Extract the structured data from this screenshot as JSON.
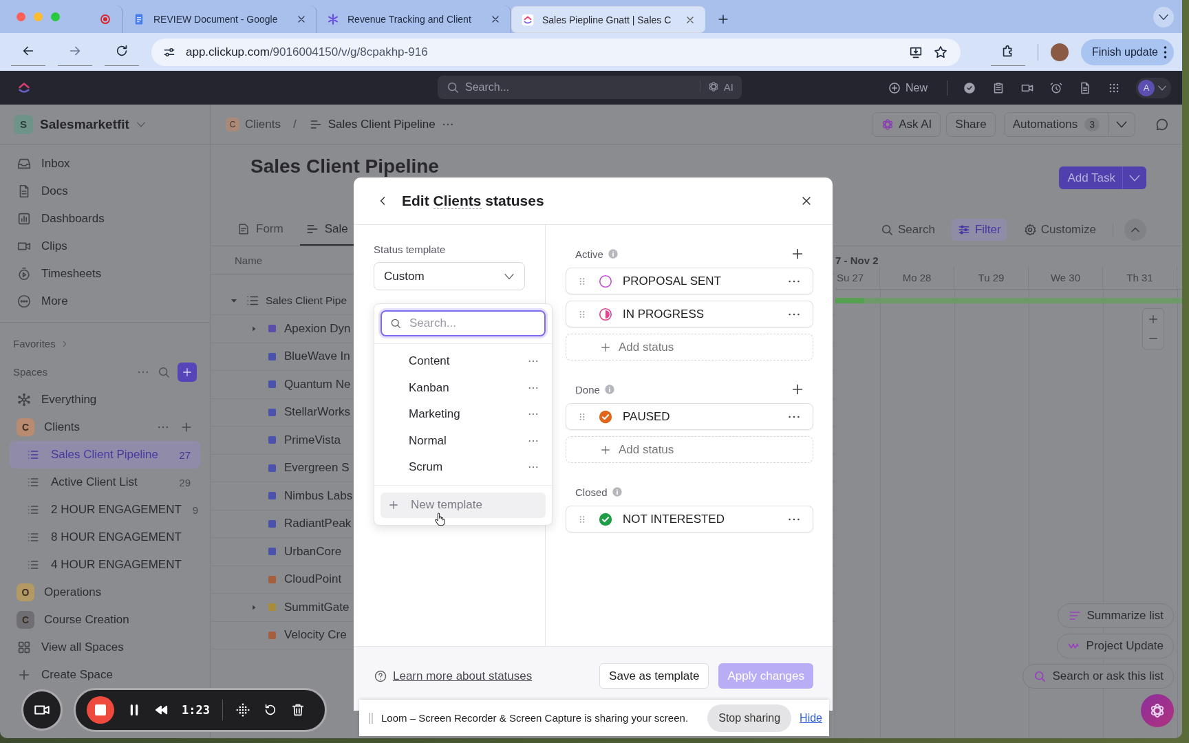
{
  "browser": {
    "tabs": [
      {
        "kind": "record",
        "selected": false
      },
      {
        "kind": "doc",
        "title": "REVIEW Document - Google",
        "selected": false
      },
      {
        "kind": "app",
        "title": "Revenue Tracking and Client",
        "selected": false
      },
      {
        "kind": "clickup",
        "title": "Sales Piepline Gnatt | Sales C",
        "selected": true
      }
    ],
    "url_host": "app.clickup.com",
    "url_path": "/9016004150/v/g/8cpakhp-916",
    "update_button": "Finish update"
  },
  "topbar": {
    "search_placeholder": "Search...",
    "ai_label": "AI",
    "new_label": "New",
    "avatar_letter": "A"
  },
  "sidebar": {
    "workspace": {
      "letter": "S",
      "name": "Salesmarketfit"
    },
    "nav": [
      {
        "kind": "inbox",
        "label": "Inbox"
      },
      {
        "kind": "doc",
        "label": "Docs"
      },
      {
        "kind": "dashboard",
        "label": "Dashboards"
      },
      {
        "kind": "clips",
        "label": "Clips"
      },
      {
        "kind": "timesheet",
        "label": "Timesheets"
      },
      {
        "kind": "more",
        "label": "More"
      }
    ],
    "favorites_label": "Favorites",
    "spaces_label": "Spaces",
    "spaces": [
      {
        "kind": "everything",
        "label": "Everything"
      },
      {
        "kind": "space",
        "letter": "C",
        "label": "Clients",
        "color": "#b98b70",
        "expanded": true,
        "children": [
          {
            "label": "Sales Client Pipeline",
            "count": "27",
            "selected": true
          },
          {
            "label": "Active Client List",
            "count": "29",
            "selected": false
          },
          {
            "label": "2 HOUR ENGAGEMENT",
            "count": "9",
            "selected": false
          },
          {
            "label": "8 HOUR ENGAGEMENT",
            "selected": false
          },
          {
            "label": "4 HOUR ENGAGEMENT",
            "selected": false
          }
        ]
      },
      {
        "kind": "space",
        "letter": "O",
        "label": "Operations",
        "color": "#b39a64",
        "expanded": false
      },
      {
        "kind": "space",
        "letter": "C",
        "label": "Course Creation",
        "color": "#6e6e73",
        "expanded": false
      },
      {
        "kind": "all",
        "label": "View all Spaces"
      },
      {
        "kind": "create",
        "label": "Create Space"
      }
    ]
  },
  "main": {
    "breadcrumb": {
      "space_letter": "C",
      "space": "Clients",
      "separator": "/",
      "list": "Sales Client Pipeline"
    },
    "ask_ai": "Ask AI",
    "share": "Share",
    "automations": {
      "label": "Automations",
      "count": "3"
    },
    "title": "Sales Client Pipeline",
    "add_task": "Add Task",
    "view_tabs": [
      {
        "kind": "form",
        "label": "Form",
        "selected": false
      },
      {
        "kind": "gantt",
        "label": "Sale",
        "selected": true
      }
    ],
    "toolbar": [
      {
        "kind": "search",
        "label": "Search",
        "active": false
      },
      {
        "kind": "filter",
        "label": "Filter",
        "active": true
      },
      {
        "kind": "customize",
        "label": "Customize",
        "active": false
      }
    ],
    "list": {
      "column": "Name",
      "group": {
        "label": "Sales Client Pipe",
        "expanded": true
      },
      "rows": [
        {
          "name": "Apexion Dyn",
          "color": "#5a4dab",
          "has_children": true
        },
        {
          "name": "BlueWave In",
          "color": "#4a52ad",
          "has_children": false
        },
        {
          "name": "Quantum Ne",
          "color": "#4a52ad",
          "has_children": false
        },
        {
          "name": "StellarWorks",
          "color": "#4a52ad",
          "has_children": false
        },
        {
          "name": "PrimeVista",
          "color": "#4a52ad",
          "has_children": false
        },
        {
          "name": "Evergreen S",
          "color": "#4a52ad",
          "has_children": false
        },
        {
          "name": "Nimbus Labs",
          "color": "#4a52ad",
          "has_children": false
        },
        {
          "name": "RadiantPeak",
          "color": "#4a52ad",
          "has_children": false
        },
        {
          "name": "UrbanCore",
          "color": "#4a52ad",
          "has_children": false
        },
        {
          "name": "CloudPoint",
          "color": "#a65f3c",
          "has_children": false
        },
        {
          "name": "SummitGate",
          "color": "#a88c3c",
          "has_children": true
        },
        {
          "name": "Velocity Cre",
          "color": "#a65f3c",
          "has_children": false
        }
      ]
    },
    "gantt": {
      "range": "7 - Nov 2",
      "days": [
        "Su 27",
        "Mo 28",
        "Tu 29",
        "We 30",
        "Th 31"
      ]
    },
    "ai_actions": [
      {
        "kind": "summarize",
        "label": "Summarize list"
      },
      {
        "kind": "update",
        "label": "Project Update"
      },
      {
        "kind": "ask",
        "label": "Search or ask this list"
      }
    ]
  },
  "modal": {
    "title_before": "Edit",
    "space": "Clients",
    "title_after": "statuses",
    "template_label": "Status template",
    "template_value": "Custom",
    "template_search_placeholder": "Search...",
    "templates": [
      {
        "label": "Content"
      },
      {
        "label": "Kanban"
      },
      {
        "label": "Marketing"
      },
      {
        "label": "Normal"
      },
      {
        "label": "Scrum"
      }
    ],
    "new_template": "New template",
    "groups": [
      {
        "label": "Active",
        "can_add": true,
        "add_label": "Add status",
        "statuses": [
          {
            "name": "PROPOSAL SENT",
            "kind": "open",
            "color": "#c250d8"
          },
          {
            "name": "IN PROGRESS",
            "kind": "in_progress",
            "color": "#e0458f"
          }
        ]
      },
      {
        "label": "Done",
        "can_add": true,
        "add_label": "Add status",
        "statuses": [
          {
            "name": "PAUSED",
            "kind": "done",
            "color": "#e0661e"
          }
        ]
      },
      {
        "label": "Closed",
        "can_add": false,
        "statuses": [
          {
            "name": "NOT INTERESTED",
            "kind": "done",
            "color": "#1f9d47"
          }
        ]
      }
    ],
    "learn_more": "Learn more about statuses",
    "save_template": "Save as template",
    "apply": {
      "label": "Apply changes",
      "disabled": true
    }
  },
  "loom": {
    "time": "1:23",
    "share_message": "Loom – Screen Recorder & Screen Capture is sharing your screen.",
    "stop_button": "Stop sharing",
    "hide_link": "Hide"
  }
}
